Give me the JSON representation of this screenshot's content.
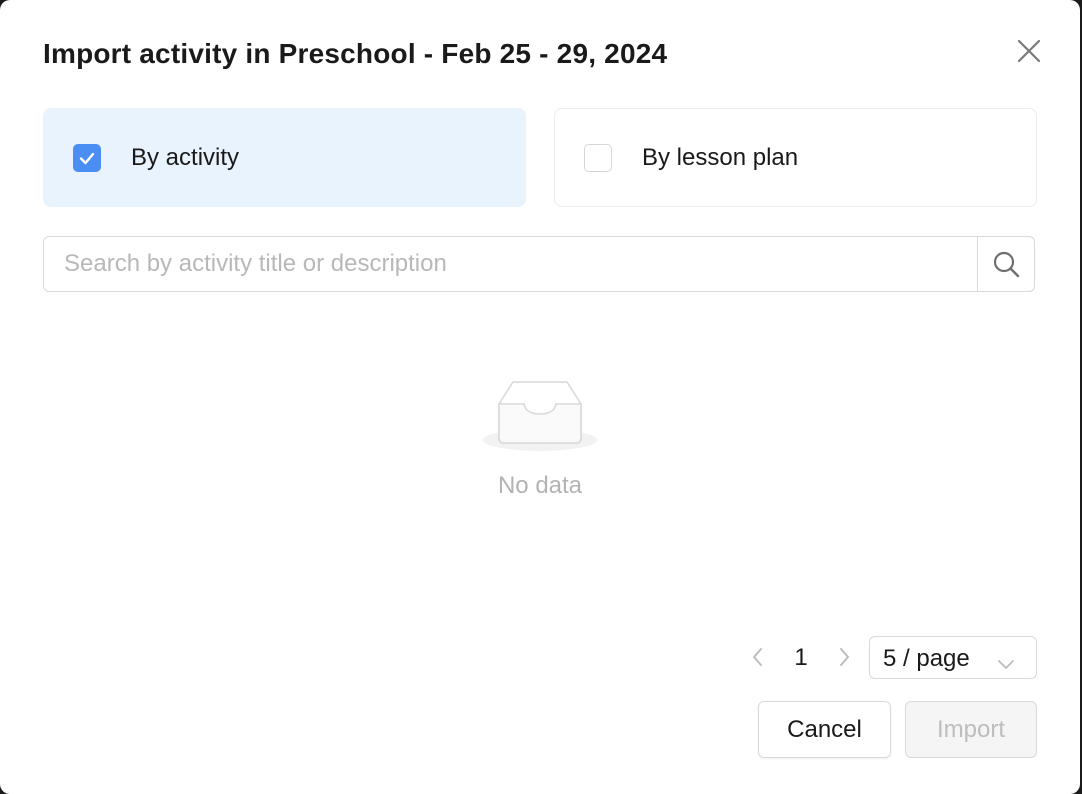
{
  "dialog": {
    "title": "Import activity in Preschool - Feb 25 - 29, 2024",
    "close_icon": "close-icon"
  },
  "options": {
    "by_activity": {
      "label": "By activity",
      "checked": true
    },
    "by_lesson_plan": {
      "label": "By lesson plan",
      "checked": false
    }
  },
  "search": {
    "placeholder": "Search by activity title or description",
    "value": "",
    "icon": "search-icon"
  },
  "empty_state": {
    "icon": "empty-inbox-icon",
    "text": "No data"
  },
  "pagination": {
    "current_page": "1",
    "page_size": "5 / page",
    "prev_icon": "chevron-left-icon",
    "next_icon": "chevron-right-icon"
  },
  "footer": {
    "cancel_label": "Cancel",
    "import_label": "Import"
  },
  "colors": {
    "accent": "#4a8ef3",
    "active_option_bg": "#e8f3fe",
    "muted_text": "#b3b3b3"
  }
}
